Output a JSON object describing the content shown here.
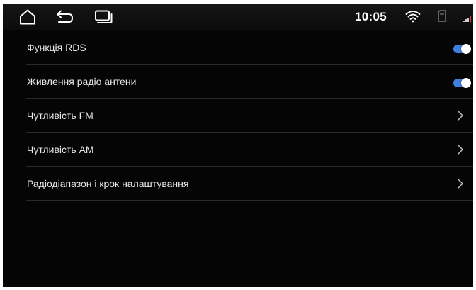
{
  "status_bar": {
    "time": "10:05",
    "nav_buttons": [
      "home-icon",
      "back-icon",
      "recents-icon"
    ],
    "status_icons": [
      "wifi-icon",
      "sd-card-icon",
      "signal-icon"
    ]
  },
  "settings": {
    "items": [
      {
        "label": "Функція RDS",
        "control": "toggle",
        "state": "on"
      },
      {
        "label": "Живлення радіо антени",
        "control": "toggle",
        "state": "on"
      },
      {
        "label": "Чутливість FM",
        "control": "chevron"
      },
      {
        "label": "Чутливість AM",
        "control": "chevron"
      },
      {
        "label": "Радіодіапазон і крок налаштування",
        "control": "chevron"
      }
    ]
  },
  "colors": {
    "background": "#050505",
    "status_bar": "#111111",
    "text": "#e8e8e8",
    "divider": "#2a2a2a",
    "toggle_accent": "#3f7fe0"
  }
}
